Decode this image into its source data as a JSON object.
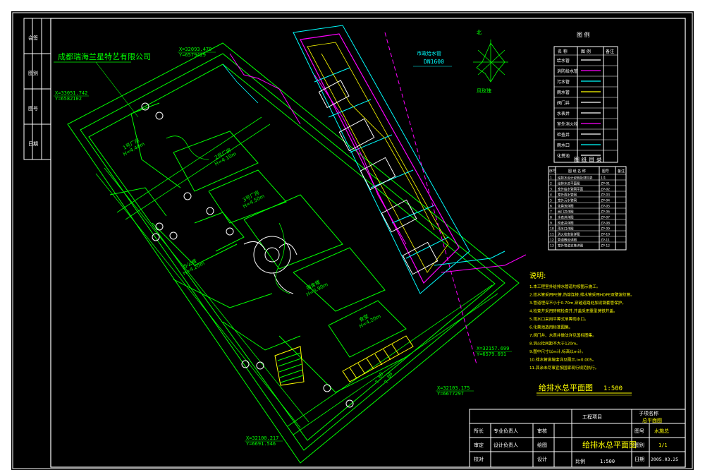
{
  "company_label": "成都瑞海兰星特艺有限公司",
  "pipe_label": "市政给水管",
  "pipe_size": "DN1600",
  "north_label": "北",
  "north_caption": "风玫瑰",
  "coords": [
    {
      "x": "X=32093.479",
      "y": "Y=6579429"
    },
    {
      "x": "X=33051.742",
      "y": "Y=6582102"
    },
    {
      "x": "X=32157.699",
      "y": "Y=6579.691"
    },
    {
      "x": "X=32103.175",
      "y": "Y=6677297"
    },
    {
      "x": "X=32100.217",
      "y": "Y=6691.546"
    }
  ],
  "buildings": [
    {
      "line1": "1号厂房",
      "line2": "H=4.40m"
    },
    {
      "line1": "2号厂房",
      "line2": "H=4.10m"
    },
    {
      "line1": "3号厂房",
      "line2": "H=4.50m"
    },
    {
      "line1": "办公楼",
      "line2": "H=4.20m"
    },
    {
      "line1": "宿舍楼",
      "line2": "H=3.90m"
    },
    {
      "line1": "食堂",
      "line2": "H=4.20m"
    }
  ],
  "dims": [
    "7.00",
    "7.00"
  ],
  "legend": {
    "title": "图 例",
    "headers": [
      "名 称",
      "图 例",
      "备注"
    ],
    "rows": [
      "给水管",
      "消防给水管",
      "污水管",
      "雨水管",
      "阀门井",
      "水表井",
      "室外消火栓",
      "检查井",
      "雨水口",
      "化粪池"
    ]
  },
  "drawing_list": {
    "title": "图 纸 目 录",
    "headers": [
      "序号",
      "图 纸 名 称",
      "图号",
      "备注"
    ],
    "rows": [
      {
        "no": "1",
        "name": "给排水设计说明及材料表",
        "code": "1/1"
      },
      {
        "no": "2",
        "name": "给排水总平面图",
        "code": "ZP-01"
      },
      {
        "no": "3",
        "name": "室外给水管网平面",
        "code": "ZP-02"
      },
      {
        "no": "4",
        "name": "室外雨水管网",
        "code": "ZP-03"
      },
      {
        "no": "5",
        "name": "室外污水管网",
        "code": "ZP-04"
      },
      {
        "no": "6",
        "name": "化粪池详图",
        "code": "ZP-05"
      },
      {
        "no": "7",
        "name": "阀门井详图",
        "code": "ZP-06"
      },
      {
        "no": "8",
        "name": "水表井详图",
        "code": "ZP-07"
      },
      {
        "no": "9",
        "name": "检查井详图",
        "code": "ZP-08"
      },
      {
        "no": "10",
        "name": "雨水口详图",
        "code": "ZP-09"
      },
      {
        "no": "11",
        "name": "消火栓安装详图",
        "code": "ZP-10"
      },
      {
        "no": "12",
        "name": "管道敷设详图",
        "code": "ZP-11"
      },
      {
        "no": "13",
        "name": "室外管道支墩详图",
        "code": "ZP-12"
      }
    ]
  },
  "notes": {
    "title": "说明:",
    "items": [
      "1.本工程室外给排水管道均按图示施工。",
      "2.给水管采用PE管,热熔连接;排水管采用HDPE双壁波纹管。",
      "3.管道埋深不小于0.70m,穿越道路处加设钢套管保护。",
      "4.检查井采用砖砌检查井,井盖采用重型铸铁井盖。",
      "5.雨水口采用平箅式单箅雨水口。",
      "6.化粪池选用标准图集。",
      "7.阀门井、水表井做法详见国标图集。",
      "8.消火栓间距不大于120m。",
      "9.图中尺寸以m计,标高以m计。",
      "10.排水管道坡度详见图示,i=0.005。",
      "11.其余未尽事宜按国家现行规范执行。"
    ]
  },
  "plan_title": "给排水总平面图",
  "plan_scale": "1:500",
  "title_block": {
    "project_label": "工程项目",
    "stage_label": "子项名称",
    "stage_value": "总平面图",
    "drawing_name": "给排水总平面图",
    "drawing_no_label": "图号",
    "drawing_no": "水施总",
    "sheet_label": "图别",
    "sheet_value": "1/1",
    "date_label": "日期",
    "date": "2005.03.25",
    "role_labels": [
      "所长",
      "审定",
      "校对",
      "审核",
      "设计负责人",
      "专业负责人",
      "绘图",
      "设计"
    ],
    "scale_label": "比例",
    "scale_value": "1:500"
  },
  "sidebar_labels": [
    "会签",
    "图别",
    "图号",
    "日期"
  ]
}
